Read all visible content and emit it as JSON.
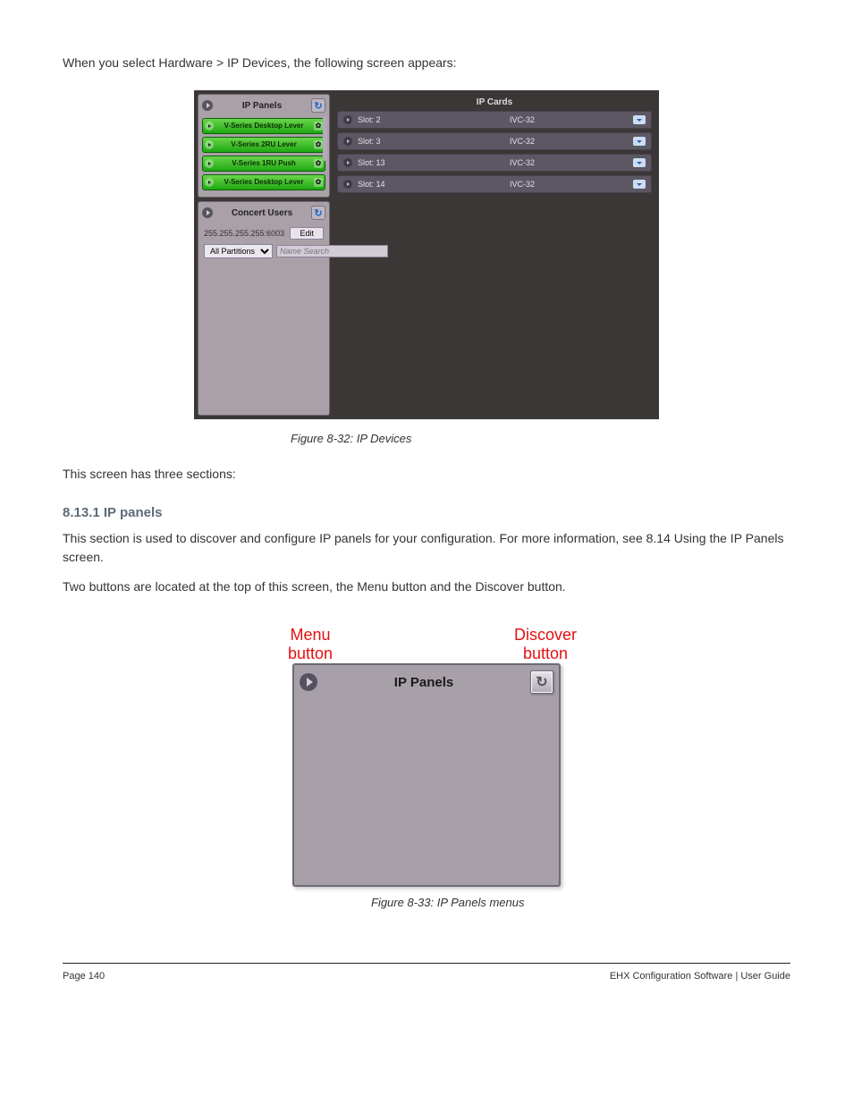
{
  "intro": {
    "p1": "When you select Hardware > IP Devices, the following screen appears:",
    "p2": "This screen has three sections:"
  },
  "ip_panels": {
    "title": "IP Panels",
    "items": [
      {
        "name": "V-Series Desktop Lever"
      },
      {
        "name": "V-Series 2RU Lever"
      },
      {
        "name": "V-Series 1RU Push"
      },
      {
        "name": "V-Series Desktop Lever"
      }
    ]
  },
  "concert": {
    "title": "Concert Users",
    "address": "255.255.255.255:6003",
    "edit": "Edit",
    "partition": "All Partitions",
    "placeholder": "Name Search"
  },
  "ip_cards": {
    "title": "IP Cards",
    "rows": [
      {
        "slot": "Slot: 2",
        "type": "IVC-32"
      },
      {
        "slot": "Slot: 3",
        "type": "IVC-32"
      },
      {
        "slot": "Slot: 13",
        "type": "IVC-32"
      },
      {
        "slot": "Slot: 14",
        "type": "IVC-32"
      }
    ]
  },
  "fig1_caption": "Figure 8-32: IP Devices",
  "body": {
    "section": "8.13.1  IP panels",
    "p1": "This section is used to discover and configure IP panels for your configuration. For more information, see 8.14 Using the IP Panels screen.",
    "p2": "Two buttons are located at the top of this screen, the Menu button and the Discover button."
  },
  "fig2": {
    "label_menu": "Menu button",
    "label_discover": "Discover button",
    "title": "IP Panels",
    "caption": "Figure 8-33: IP Panels menus"
  },
  "footer": {
    "page": "Page 140",
    "title": "EHX Configuration Software | User Guide"
  }
}
